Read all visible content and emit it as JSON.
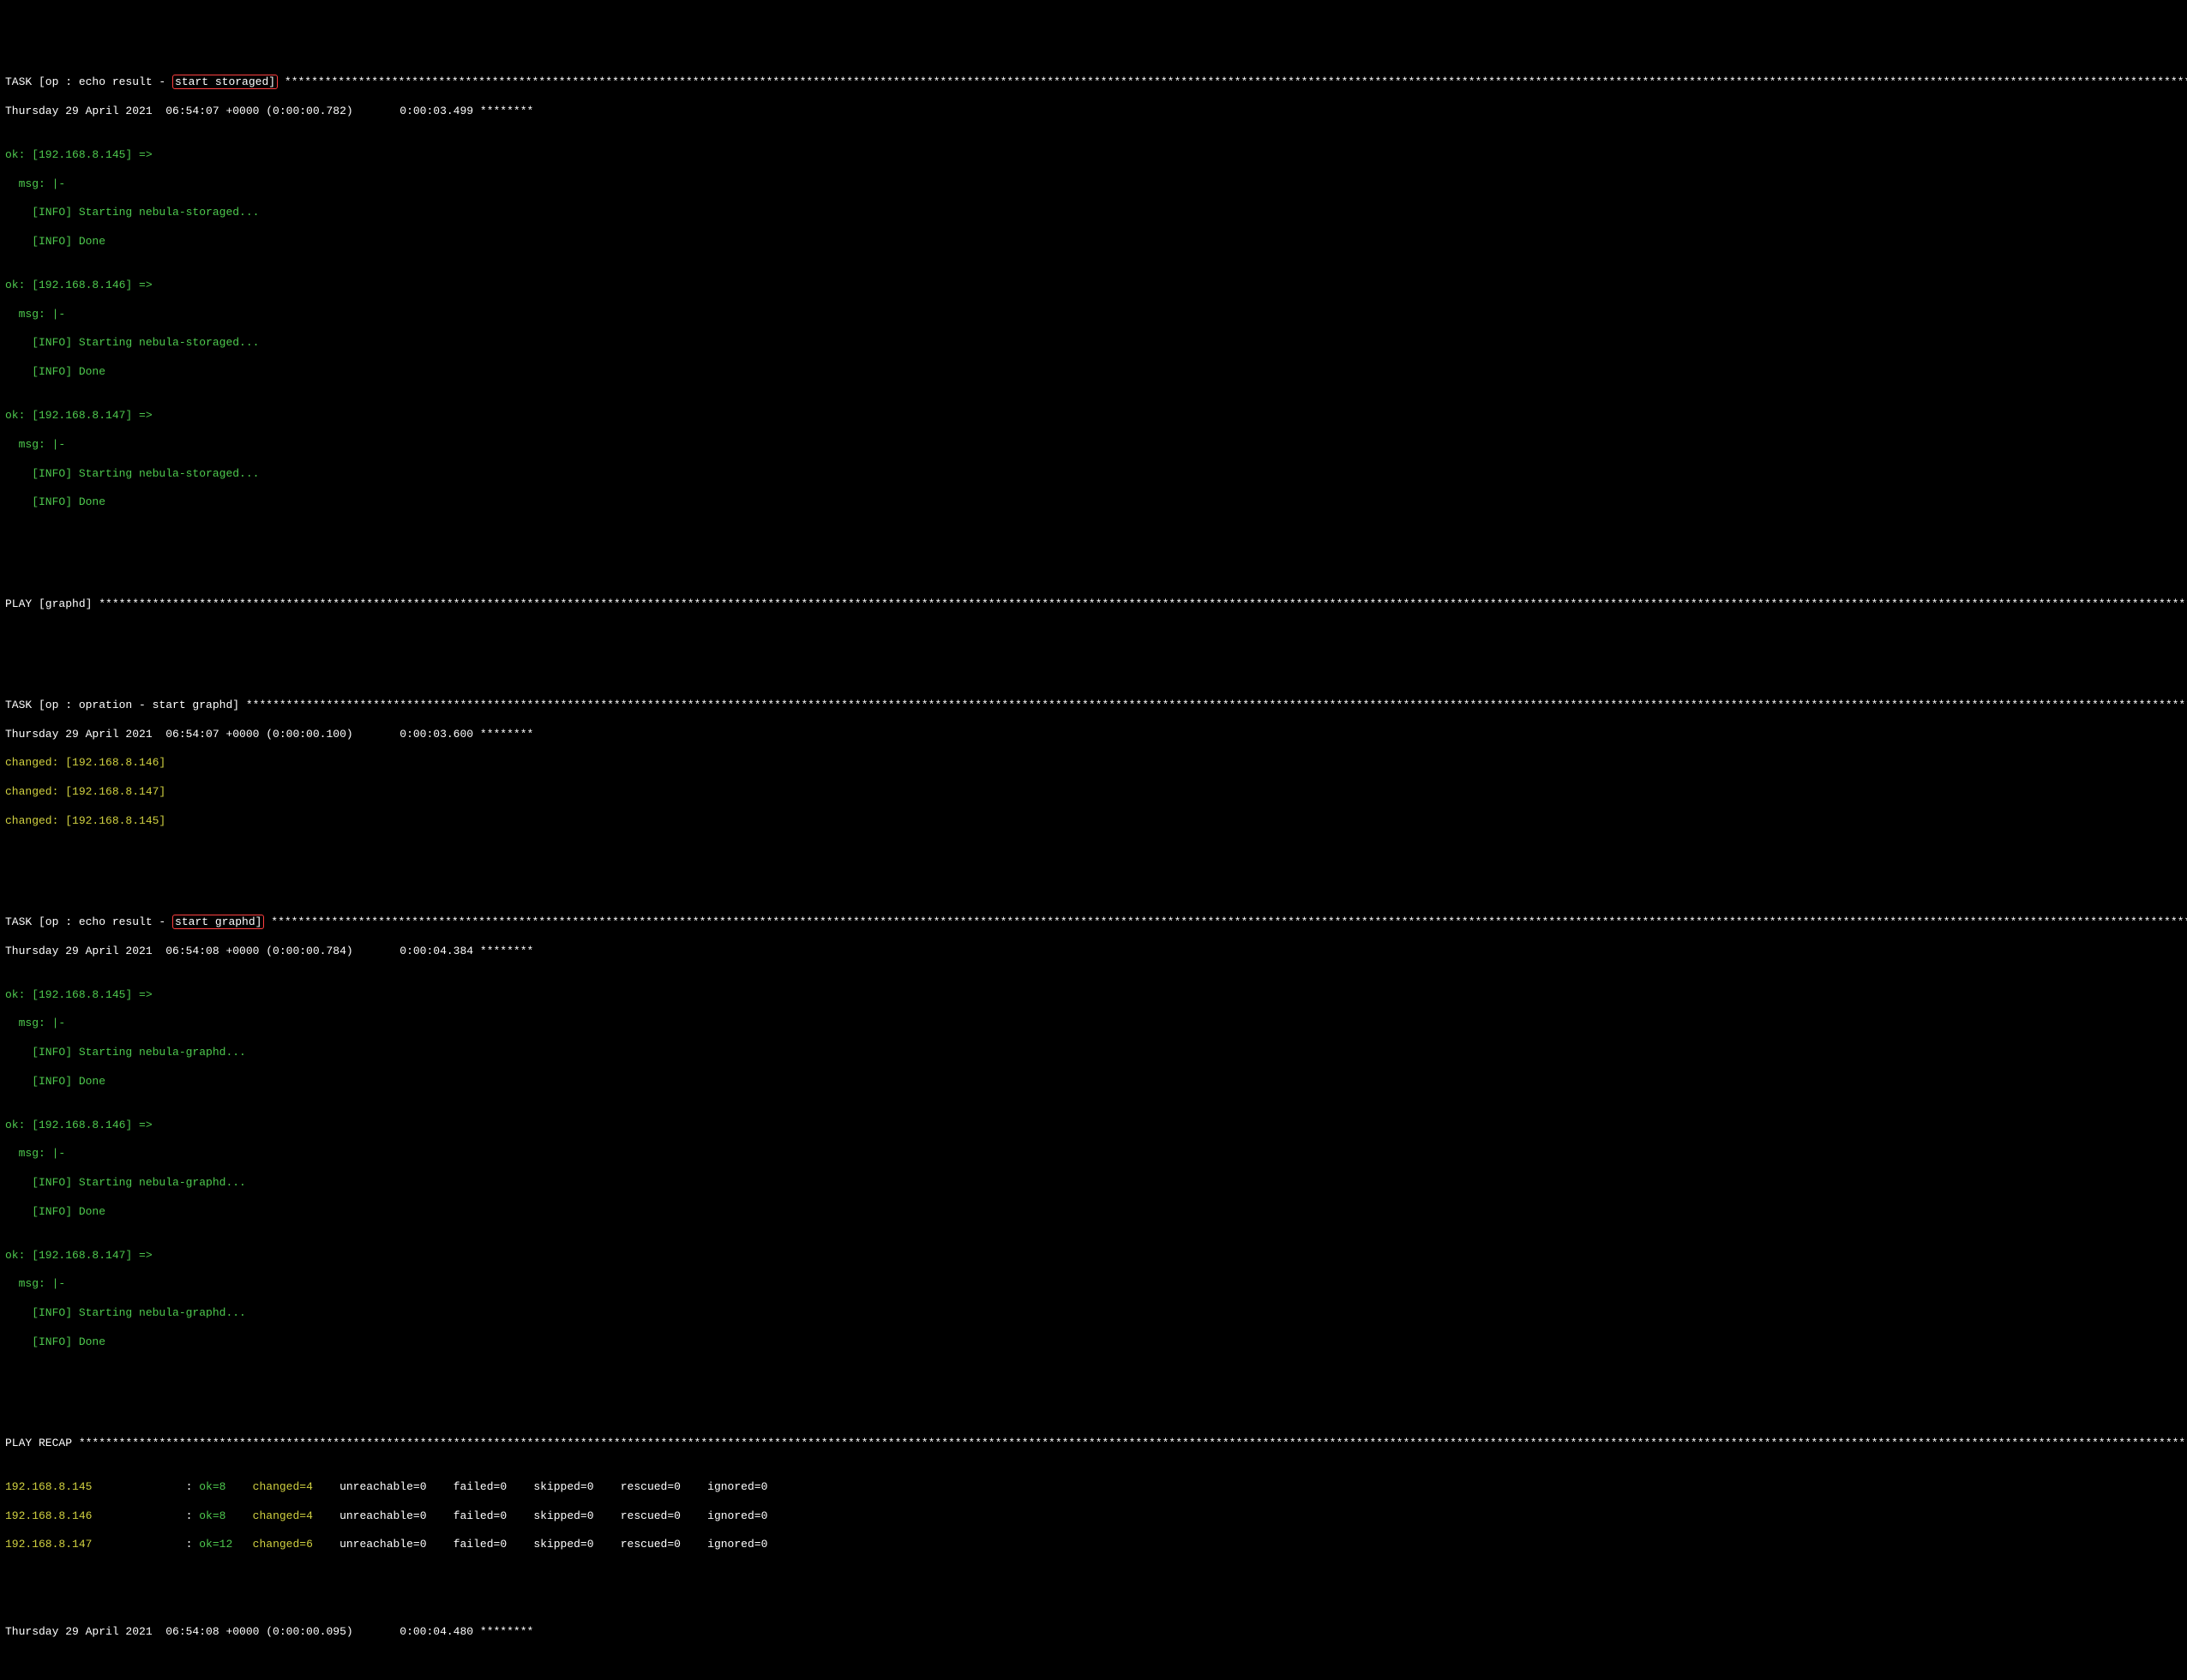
{
  "asterisks_long": "********************************************************************************************************************************************************************************************************************************************************************************************************************************",
  "asterisks_med": "********************************************************************************************************************************************************************************************************************************************************************************************************************",
  "asterisks_short": "********",
  "tasks": {
    "echo_storaged": {
      "prefix": "TASK [op : echo result - ",
      "highlight": "start storaged]",
      "suffix": " ",
      "timestamp": "Thursday 29 April 2021  06:54:07 +0000 (0:00:00.782)       0:00:03.499 ",
      "hosts": [
        {
          "header": "ok: [192.168.8.145] =>",
          "msg_label": "  msg: |-",
          "lines": [
            "    [INFO] Starting nebula-storaged...",
            "    [INFO] Done"
          ]
        },
        {
          "header": "ok: [192.168.8.146] =>",
          "msg_label": "  msg: |-",
          "lines": [
            "    [INFO] Starting nebula-storaged...",
            "    [INFO] Done"
          ]
        },
        {
          "header": "ok: [192.168.8.147] =>",
          "msg_label": "  msg: |-",
          "lines": [
            "    [INFO] Starting nebula-storaged...",
            "    [INFO] Done"
          ]
        }
      ]
    },
    "play_graphd": {
      "prefix": "PLAY [graphd] "
    },
    "opration_graphd": {
      "prefix": "TASK [op : opration - start graphd] ",
      "timestamp": "Thursday 29 April 2021  06:54:07 +0000 (0:00:00.100)       0:00:03.600 ",
      "changed": [
        "changed: [192.168.8.146]",
        "changed: [192.168.8.147]",
        "changed: [192.168.8.145]"
      ]
    },
    "echo_graphd": {
      "prefix": "TASK [op : echo result - ",
      "highlight": "start graphd]",
      "suffix": " ",
      "timestamp": "Thursday 29 April 2021  06:54:08 +0000 (0:00:00.784)       0:00:04.384 ",
      "hosts": [
        {
          "header": "ok: [192.168.8.145] =>",
          "msg_label": "  msg: |-",
          "lines": [
            "    [INFO] Starting nebula-graphd...",
            "    [INFO] Done"
          ]
        },
        {
          "header": "ok: [192.168.8.146] =>",
          "msg_label": "  msg: |-",
          "lines": [
            "    [INFO] Starting nebula-graphd...",
            "    [INFO] Done"
          ]
        },
        {
          "header": "ok: [192.168.8.147] =>",
          "msg_label": "  msg: |-",
          "lines": [
            "    [INFO] Starting nebula-graphd...",
            "    [INFO] Done"
          ]
        }
      ]
    },
    "play_recap": {
      "prefix": "PLAY RECAP ",
      "rows": [
        {
          "host": "192.168.8.145             ",
          "colon": " : ",
          "ok": "ok=8   ",
          "changed": " changed=4   ",
          "rest": " unreachable=0    failed=0    skipped=0    rescued=0    ignored=0"
        },
        {
          "host": "192.168.8.146             ",
          "colon": " : ",
          "ok": "ok=8   ",
          "changed": " changed=4   ",
          "rest": " unreachable=0    failed=0    skipped=0    rescued=0    ignored=0"
        },
        {
          "host": "192.168.8.147             ",
          "colon": " : ",
          "ok": "ok=12  ",
          "changed": " changed=6   ",
          "rest": " unreachable=0    failed=0    skipped=0    rescued=0    ignored=0"
        }
      ]
    },
    "footer_ts": "Thursday 29 April 2021  06:54:08 +0000 (0:00:00.095)       0:00:04.480 "
  }
}
